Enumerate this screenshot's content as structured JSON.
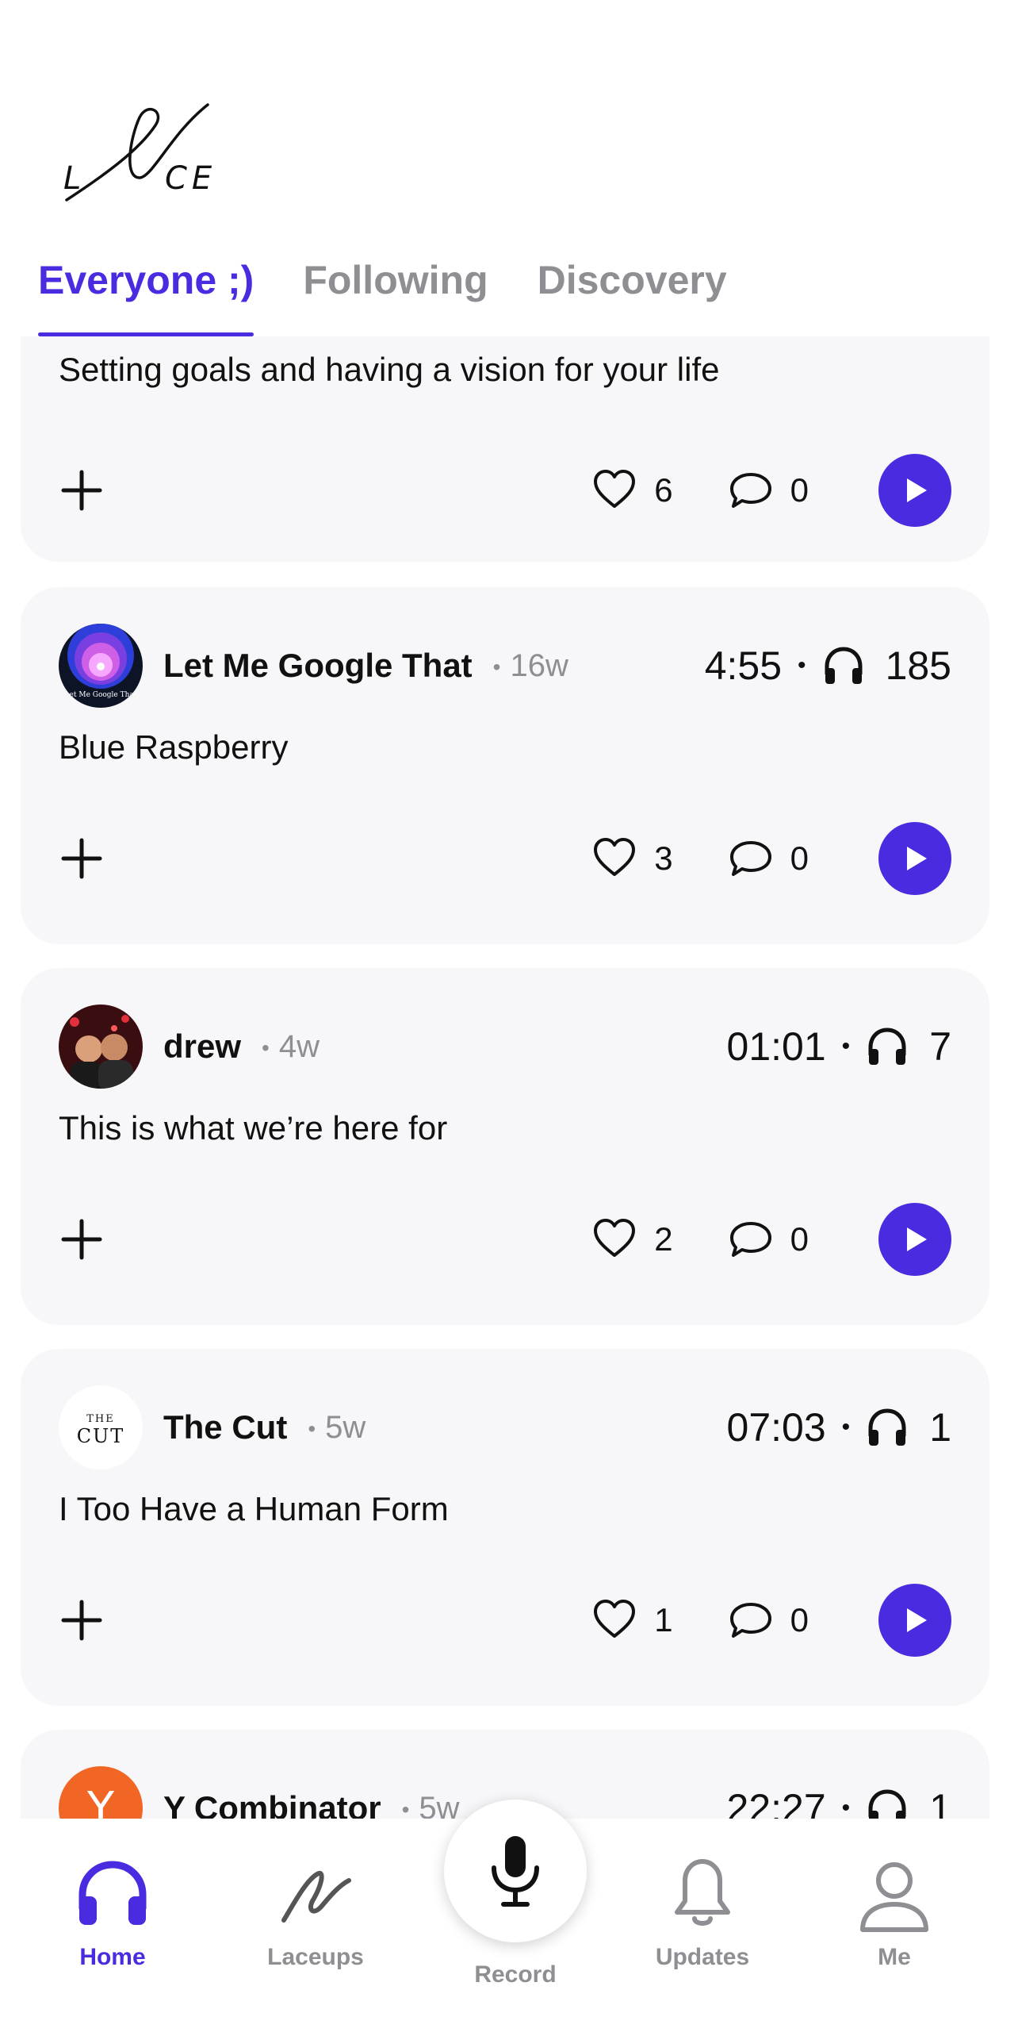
{
  "app": {
    "logo_text": "LACE"
  },
  "tabs": [
    {
      "label": "Everyone ;)",
      "active": true
    },
    {
      "label": "Following",
      "active": false
    },
    {
      "label": "Discovery",
      "active": false
    }
  ],
  "posts": [
    {
      "title": "Setting goals and having a vision for your life",
      "likes": "6",
      "comments": "0"
    },
    {
      "author": "Let Me Google That",
      "age": "16w",
      "duration": "4:55",
      "listens": "185",
      "title": "Blue Raspberry",
      "likes": "3",
      "comments": "0"
    },
    {
      "author": "drew",
      "age": "4w",
      "duration": "01:01",
      "listens": "7",
      "title": "This is what we’re here for",
      "likes": "2",
      "comments": "0"
    },
    {
      "author": "The Cut",
      "age": "5w",
      "duration": "07:03",
      "listens": "1",
      "title": "I Too Have a Human Form",
      "likes": "1",
      "comments": "0"
    },
    {
      "author": "Y Combinator",
      "age": "5w",
      "duration": "22:27",
      "listens": "1"
    }
  ],
  "avatars": {
    "let_me_google_that": "Let Me Google That",
    "the_cut_top": "THE",
    "the_cut_bottom": "CUT",
    "y_combinator": "Y"
  },
  "bottom_nav": {
    "home": "Home",
    "laceups": "Laceups",
    "record": "Record",
    "updates": "Updates",
    "me": "Me"
  },
  "colors": {
    "accent": "#4a2be0",
    "card_bg": "#f7f7f9",
    "muted": "#8e8e93"
  }
}
